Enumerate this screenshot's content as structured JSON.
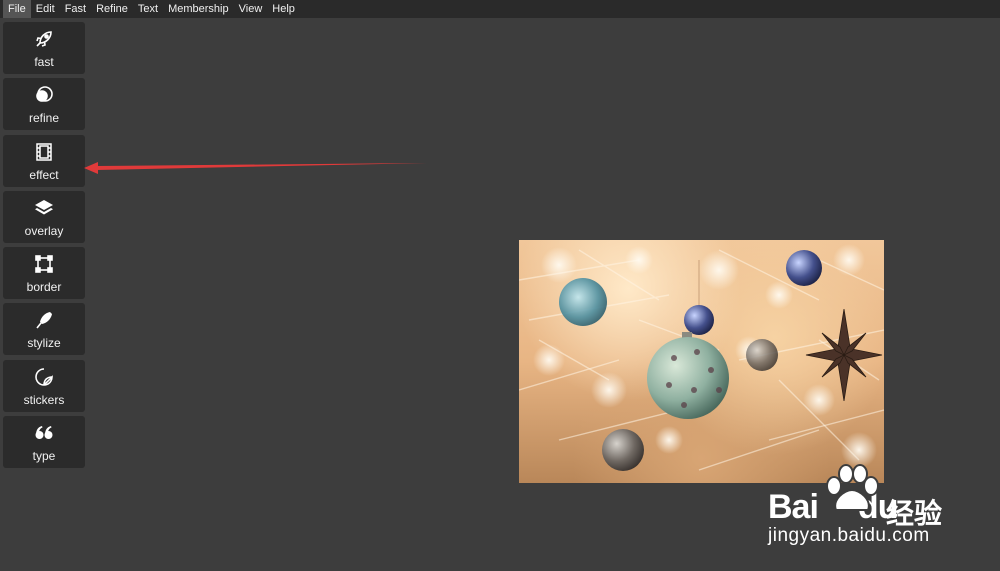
{
  "menubar": {
    "items": [
      "File",
      "Edit",
      "Fast",
      "Refine",
      "Text",
      "Membership",
      "View",
      "Help"
    ]
  },
  "toolbar": {
    "tools": [
      {
        "label": "fast",
        "icon": "rocket-icon"
      },
      {
        "label": "refine",
        "icon": "refine-circles-icon"
      },
      {
        "label": "effect",
        "icon": "film-strip-icon"
      },
      {
        "label": "overlay",
        "icon": "layers-icon"
      },
      {
        "label": "border",
        "icon": "border-frame-icon"
      },
      {
        "label": "stylize",
        "icon": "feather-brush-icon"
      },
      {
        "label": "stickers",
        "icon": "sticker-icon"
      },
      {
        "label": "type",
        "icon": "quote-icon"
      }
    ]
  },
  "annotation": {
    "color": "#e03a3a",
    "points_to": "effect"
  },
  "watermark": {
    "brand_latin": "Bai",
    "brand_latin_2": "du",
    "brand_cn": "经验",
    "url": "jingyan.baidu.com"
  },
  "colors": {
    "background": "#3d3d3d",
    "menubar": "#2a2a2a",
    "tool_bg": "#2b2b2b",
    "arrow": "#e03a3a"
  }
}
